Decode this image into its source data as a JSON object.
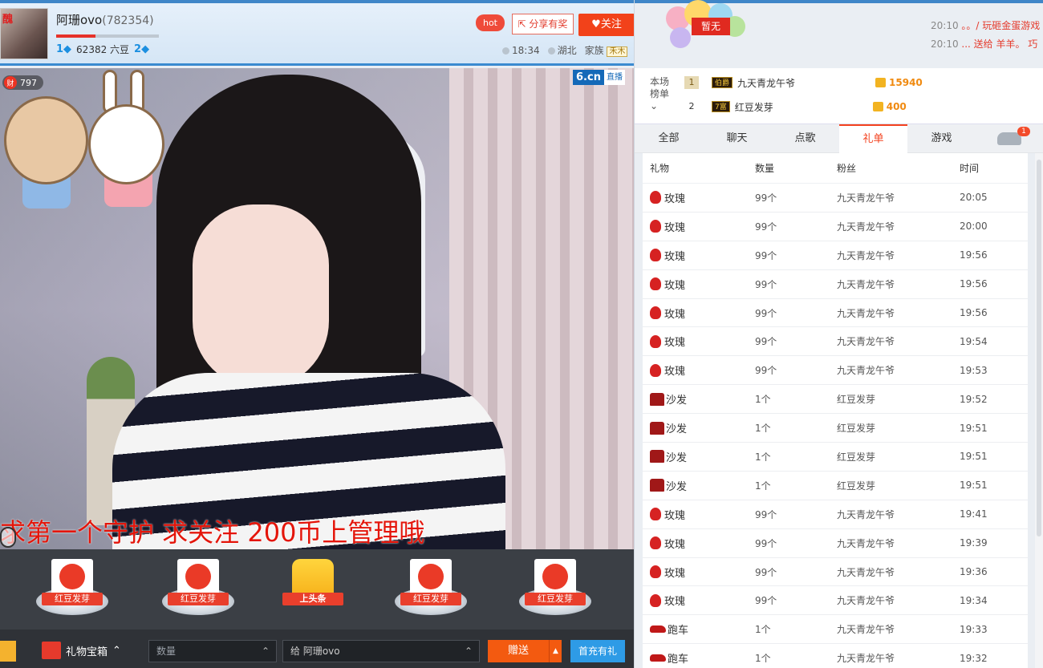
{
  "header": {
    "avatar_tag": "醜",
    "anchor_name": "阿珊ovo",
    "anchor_id": "(782354)",
    "level_left": "1",
    "beans": "62382 六豆",
    "level_right": "2",
    "hot_label": "hot",
    "share_label": "分享有奖",
    "follow_label": "关注",
    "time": "18:34",
    "location": "湖北",
    "family_label": "家族",
    "family_badge": "禾木"
  },
  "video": {
    "cai_count": "797",
    "cai_icon": "财",
    "logo": "6.cn",
    "logo_live": "直播",
    "subtitle": "求第一个守护  求关注  200币上管理哦"
  },
  "gift_row": [
    {
      "label": "红豆发芽"
    },
    {
      "label": "红豆发芽"
    },
    {
      "label": "上头条"
    },
    {
      "label": "红豆发芽"
    },
    {
      "label": "红豆发芽"
    }
  ],
  "bottom": {
    "gift_box_label": "礼物宝箱",
    "qty_placeholder": "数量",
    "to_label": "给  阿珊ovo",
    "send_label": "赠送",
    "charge_label": "首充有礼"
  },
  "top_right": {
    "badge": "暂无",
    "ticker": [
      {
        "time": "20:10",
        "text": "。。/ 玩砸金蛋游戏"
      },
      {
        "time": "20:10",
        "text": "...  送给 羊羊。 巧"
      }
    ]
  },
  "rank": {
    "label": "本场榜单",
    "rows": [
      {
        "rank": "1",
        "badge": "伯爵",
        "name": "九天青龙午爷",
        "value": "15940"
      },
      {
        "rank": "2",
        "badge": "7富",
        "name": "红豆发芽",
        "value": "400"
      }
    ]
  },
  "tabs": [
    "全部",
    "聊天",
    "点歌",
    "礼单",
    "游戏"
  ],
  "tab_badge": "1",
  "table": {
    "headers": [
      "礼物",
      "数量",
      "粉丝",
      "时间"
    ],
    "rows": [
      {
        "icon": "rose",
        "gift": "玫瑰",
        "qty": "99个",
        "fan": "九天青龙午爷",
        "time": "20:05"
      },
      {
        "icon": "rose",
        "gift": "玫瑰",
        "qty": "99个",
        "fan": "九天青龙午爷",
        "time": "20:00"
      },
      {
        "icon": "rose",
        "gift": "玫瑰",
        "qty": "99个",
        "fan": "九天青龙午爷",
        "time": "19:56"
      },
      {
        "icon": "rose",
        "gift": "玫瑰",
        "qty": "99个",
        "fan": "九天青龙午爷",
        "time": "19:56"
      },
      {
        "icon": "rose",
        "gift": "玫瑰",
        "qty": "99个",
        "fan": "九天青龙午爷",
        "time": "19:56"
      },
      {
        "icon": "rose",
        "gift": "玫瑰",
        "qty": "99个",
        "fan": "九天青龙午爷",
        "time": "19:54"
      },
      {
        "icon": "rose",
        "gift": "玫瑰",
        "qty": "99个",
        "fan": "九天青龙午爷",
        "time": "19:53"
      },
      {
        "icon": "sofa",
        "gift": "沙发",
        "qty": "1个",
        "fan": "红豆发芽",
        "time": "19:52"
      },
      {
        "icon": "sofa",
        "gift": "沙发",
        "qty": "1个",
        "fan": "红豆发芽",
        "time": "19:51"
      },
      {
        "icon": "sofa",
        "gift": "沙发",
        "qty": "1个",
        "fan": "红豆发芽",
        "time": "19:51"
      },
      {
        "icon": "sofa",
        "gift": "沙发",
        "qty": "1个",
        "fan": "红豆发芽",
        "time": "19:51"
      },
      {
        "icon": "rose",
        "gift": "玫瑰",
        "qty": "99个",
        "fan": "九天青龙午爷",
        "time": "19:41"
      },
      {
        "icon": "rose",
        "gift": "玫瑰",
        "qty": "99个",
        "fan": "九天青龙午爷",
        "time": "19:39"
      },
      {
        "icon": "rose",
        "gift": "玫瑰",
        "qty": "99个",
        "fan": "九天青龙午爷",
        "time": "19:36"
      },
      {
        "icon": "rose",
        "gift": "玫瑰",
        "qty": "99个",
        "fan": "九天青龙午爷",
        "time": "19:34"
      },
      {
        "icon": "car",
        "gift": "跑车",
        "qty": "1个",
        "fan": "九天青龙午爷",
        "time": "19:33"
      },
      {
        "icon": "car",
        "gift": "跑车",
        "qty": "1个",
        "fan": "九天青龙午爷",
        "time": "19:32"
      }
    ]
  }
}
